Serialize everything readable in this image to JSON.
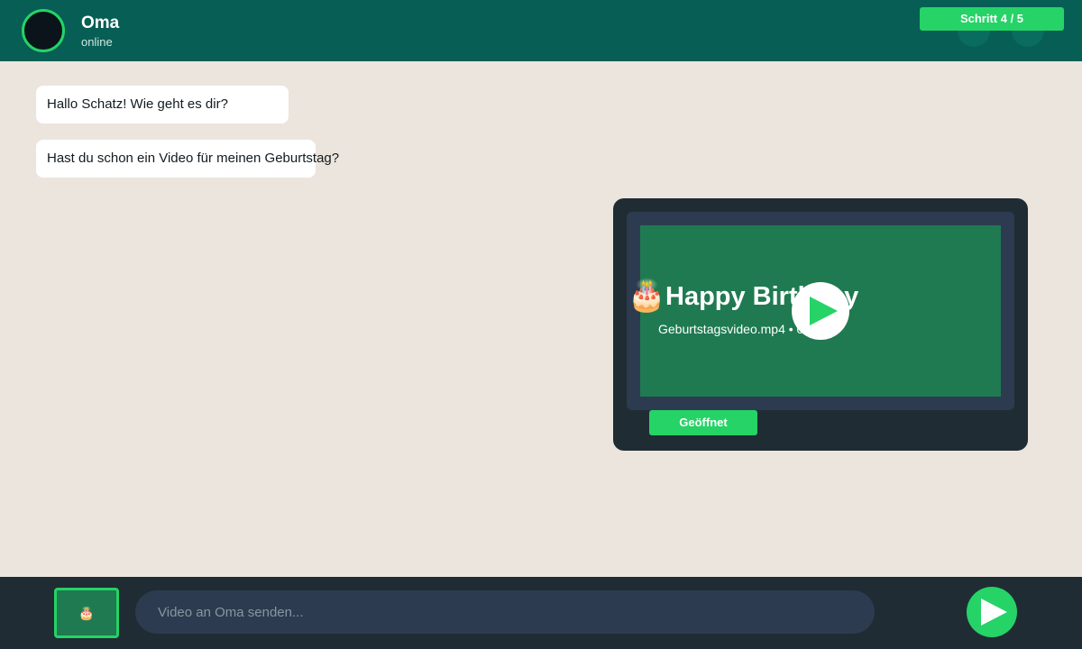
{
  "header": {
    "contact_name": "Oma",
    "status": "online",
    "step_badge": "Schritt 4 / 5"
  },
  "messages": [
    {
      "text": "Hallo Schatz! Wie geht es dir?"
    },
    {
      "text": "Hast du schon ein Video für meinen Geburtstag?"
    }
  ],
  "video_card": {
    "icon": "birthday-cake-icon",
    "icon_glyph": "🎂",
    "title": "Happy Birthday",
    "meta": "Geburtstagsvideo.mp4 • 0:30",
    "status_label": "Geöffnet"
  },
  "composer": {
    "attachment_icon": "birthday-cake-icon",
    "attachment_glyph": "🎂",
    "placeholder": "Video an Oma senden..."
  },
  "colors": {
    "header": "#075e54",
    "accent": "#25d366",
    "chat_background": "#ece5dd",
    "panel_dark": "#202c33",
    "video_thumbnail": "#1f7a51"
  }
}
